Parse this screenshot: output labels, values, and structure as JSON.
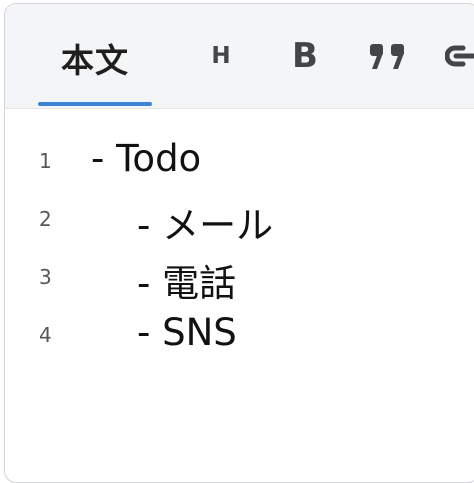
{
  "toolbar": {
    "active_tab": "本文",
    "tools": [
      {
        "label": "H",
        "icon": "heading-icon"
      },
      {
        "label": "B",
        "icon": "bold-icon"
      },
      {
        "label": "99",
        "icon": "quote-icon"
      },
      {
        "label": "",
        "icon": "link-icon"
      }
    ]
  },
  "colors": {
    "accent": "#3d84d9",
    "toolbar_bg": "#f4f5f6",
    "text": "#111111",
    "line_number": "#55575c"
  },
  "editor": {
    "lines": [
      {
        "number": "1",
        "text": "- Todo"
      },
      {
        "number": "2",
        "text": "- メール"
      },
      {
        "number": "3",
        "text": "- 電話"
      },
      {
        "number": "4",
        "text": "- SNS"
      }
    ]
  }
}
